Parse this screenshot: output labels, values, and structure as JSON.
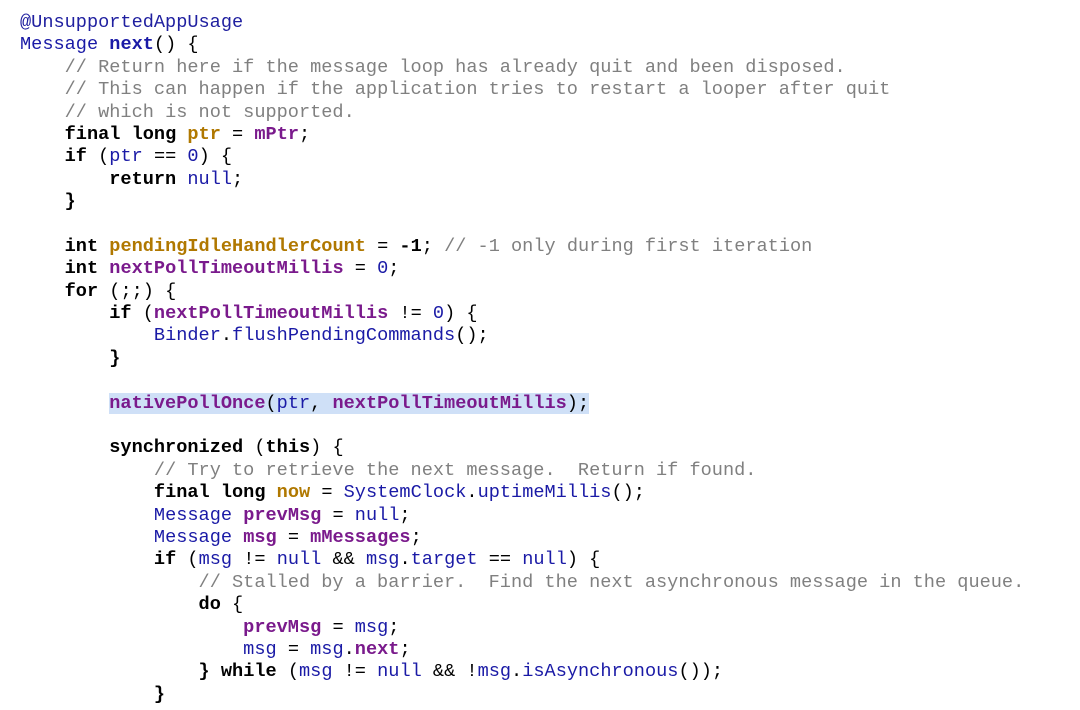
{
  "editor": {
    "lines": [
      {
        "indent": "",
        "tokens": [
          {
            "t": "@UnsupportedAppUsage",
            "c": "ann"
          }
        ]
      },
      {
        "indent": "",
        "tokens": [
          {
            "t": "Message",
            "c": "type"
          },
          {
            "t": " ",
            "c": "punc"
          },
          {
            "t": "next",
            "c": "call",
            "b": true
          },
          {
            "t": "() {",
            "c": "punc"
          }
        ]
      },
      {
        "indent": "    ",
        "tokens": [
          {
            "t": "// Return here if the message loop has already quit and been disposed.",
            "c": "com"
          }
        ]
      },
      {
        "indent": "    ",
        "tokens": [
          {
            "t": "// This can happen if the application tries to restart a looper after quit",
            "c": "com"
          }
        ]
      },
      {
        "indent": "    ",
        "tokens": [
          {
            "t": "// which is not supported.",
            "c": "com"
          }
        ]
      },
      {
        "indent": "    ",
        "tokens": [
          {
            "t": "final long",
            "c": "kw"
          },
          {
            "t": " ",
            "c": "punc"
          },
          {
            "t": "ptr",
            "c": "ptr"
          },
          {
            "t": " = ",
            "c": "punc"
          },
          {
            "t": "mPtr",
            "c": "field"
          },
          {
            "t": ";",
            "c": "punc"
          }
        ]
      },
      {
        "indent": "    ",
        "tokens": [
          {
            "t": "if",
            "c": "kw"
          },
          {
            "t": " (",
            "c": "punc"
          },
          {
            "t": "ptr",
            "c": "var"
          },
          {
            "t": " == ",
            "c": "punc"
          },
          {
            "t": "0",
            "c": "num"
          },
          {
            "t": ") {",
            "c": "punc"
          }
        ]
      },
      {
        "indent": "        ",
        "tokens": [
          {
            "t": "return",
            "c": "kw"
          },
          {
            "t": " ",
            "c": "punc"
          },
          {
            "t": "null",
            "c": "lit"
          },
          {
            "t": ";",
            "c": "punc"
          }
        ]
      },
      {
        "indent": "    ",
        "tokens": [
          {
            "t": "}",
            "c": "kw"
          }
        ]
      },
      {
        "indent": "",
        "tokens": []
      },
      {
        "indent": "    ",
        "tokens": [
          {
            "t": "int",
            "c": "kw"
          },
          {
            "t": " ",
            "c": "punc"
          },
          {
            "t": "pendingIdleHandlerCount",
            "c": "ptr"
          },
          {
            "t": " = ",
            "c": "punc"
          },
          {
            "t": "-1",
            "c": "kw"
          },
          {
            "t": "; ",
            "c": "punc"
          },
          {
            "t": "// -1 only during first iteration",
            "c": "com"
          }
        ]
      },
      {
        "indent": "    ",
        "tokens": [
          {
            "t": "int",
            "c": "kw"
          },
          {
            "t": " ",
            "c": "punc"
          },
          {
            "t": "nextPollTimeoutMillis",
            "c": "local"
          },
          {
            "t": " = ",
            "c": "punc"
          },
          {
            "t": "0",
            "c": "num"
          },
          {
            "t": ";",
            "c": "punc"
          }
        ]
      },
      {
        "indent": "    ",
        "tokens": [
          {
            "t": "for",
            "c": "kw"
          },
          {
            "t": " (;;) {",
            "c": "punc"
          }
        ]
      },
      {
        "indent": "        ",
        "tokens": [
          {
            "t": "if",
            "c": "kw"
          },
          {
            "t": " (",
            "c": "punc"
          },
          {
            "t": "nextPollTimeoutMillis",
            "c": "local"
          },
          {
            "t": " != ",
            "c": "punc"
          },
          {
            "t": "0",
            "c": "num"
          },
          {
            "t": ") {",
            "c": "punc"
          }
        ]
      },
      {
        "indent": "            ",
        "tokens": [
          {
            "t": "Binder",
            "c": "type"
          },
          {
            "t": ".",
            "c": "punc"
          },
          {
            "t": "flushPendingCommands",
            "c": "call"
          },
          {
            "t": "();",
            "c": "punc"
          }
        ]
      },
      {
        "indent": "        ",
        "tokens": [
          {
            "t": "}",
            "c": "kw"
          }
        ]
      },
      {
        "indent": "",
        "tokens": []
      },
      {
        "indent": "        ",
        "highlight": true,
        "tokens": [
          {
            "t": "nativePollOnce",
            "c": "local"
          },
          {
            "t": "(",
            "c": "punc"
          },
          {
            "t": "ptr",
            "c": "var"
          },
          {
            "t": ", ",
            "c": "punc"
          },
          {
            "t": "nextPollTimeoutMillis",
            "c": "local"
          },
          {
            "t": ");",
            "c": "punc"
          }
        ]
      },
      {
        "indent": "",
        "tokens": []
      },
      {
        "indent": "        ",
        "tokens": [
          {
            "t": "synchronized",
            "c": "kw"
          },
          {
            "t": " (",
            "c": "punc"
          },
          {
            "t": "this",
            "c": "kw"
          },
          {
            "t": ") {",
            "c": "punc"
          }
        ]
      },
      {
        "indent": "            ",
        "tokens": [
          {
            "t": "// Try to retrieve the next message.  Return if found.",
            "c": "com"
          }
        ]
      },
      {
        "indent": "            ",
        "tokens": [
          {
            "t": "final long",
            "c": "kw"
          },
          {
            "t": " ",
            "c": "punc"
          },
          {
            "t": "now",
            "c": "ptr"
          },
          {
            "t": " = ",
            "c": "punc"
          },
          {
            "t": "SystemClock",
            "c": "type"
          },
          {
            "t": ".",
            "c": "punc"
          },
          {
            "t": "uptimeMillis",
            "c": "call"
          },
          {
            "t": "();",
            "c": "punc"
          }
        ]
      },
      {
        "indent": "            ",
        "tokens": [
          {
            "t": "Message",
            "c": "type"
          },
          {
            "t": " ",
            "c": "punc"
          },
          {
            "t": "prevMsg",
            "c": "local"
          },
          {
            "t": " = ",
            "c": "punc"
          },
          {
            "t": "null",
            "c": "lit"
          },
          {
            "t": ";",
            "c": "punc"
          }
        ]
      },
      {
        "indent": "            ",
        "tokens": [
          {
            "t": "Message",
            "c": "type"
          },
          {
            "t": " ",
            "c": "punc"
          },
          {
            "t": "msg",
            "c": "local"
          },
          {
            "t": " = ",
            "c": "punc"
          },
          {
            "t": "mMessages",
            "c": "field"
          },
          {
            "t": ";",
            "c": "punc"
          }
        ]
      },
      {
        "indent": "            ",
        "tokens": [
          {
            "t": "if",
            "c": "kw"
          },
          {
            "t": " (",
            "c": "punc"
          },
          {
            "t": "msg",
            "c": "var"
          },
          {
            "t": " != ",
            "c": "punc"
          },
          {
            "t": "null",
            "c": "lit"
          },
          {
            "t": " && ",
            "c": "punc"
          },
          {
            "t": "msg",
            "c": "var"
          },
          {
            "t": ".",
            "c": "punc"
          },
          {
            "t": "target",
            "c": "var"
          },
          {
            "t": " == ",
            "c": "punc"
          },
          {
            "t": "null",
            "c": "lit"
          },
          {
            "t": ") {",
            "c": "punc"
          }
        ]
      },
      {
        "indent": "                ",
        "tokens": [
          {
            "t": "// Stalled by a barrier.  Find the next asynchronous message in the queue.",
            "c": "com"
          }
        ]
      },
      {
        "indent": "                ",
        "tokens": [
          {
            "t": "do",
            "c": "kw"
          },
          {
            "t": " {",
            "c": "punc"
          }
        ]
      },
      {
        "indent": "                    ",
        "tokens": [
          {
            "t": "prevMsg",
            "c": "local"
          },
          {
            "t": " = ",
            "c": "punc"
          },
          {
            "t": "msg",
            "c": "var"
          },
          {
            "t": ";",
            "c": "punc"
          }
        ]
      },
      {
        "indent": "                    ",
        "tokens": [
          {
            "t": "msg",
            "c": "var"
          },
          {
            "t": " = ",
            "c": "punc"
          },
          {
            "t": "msg",
            "c": "var"
          },
          {
            "t": ".",
            "c": "punc"
          },
          {
            "t": "next",
            "c": "local"
          },
          {
            "t": ";",
            "c": "punc"
          }
        ]
      },
      {
        "indent": "                ",
        "tokens": [
          {
            "t": "}",
            "c": "kw"
          },
          {
            "t": " ",
            "c": "punc"
          },
          {
            "t": "while",
            "c": "kw"
          },
          {
            "t": " (",
            "c": "punc"
          },
          {
            "t": "msg",
            "c": "var"
          },
          {
            "t": " != ",
            "c": "punc"
          },
          {
            "t": "null",
            "c": "lit"
          },
          {
            "t": " && !",
            "c": "punc"
          },
          {
            "t": "msg",
            "c": "var"
          },
          {
            "t": ".",
            "c": "punc"
          },
          {
            "t": "isAsynchronous",
            "c": "call"
          },
          {
            "t": "());",
            "c": "punc"
          }
        ]
      },
      {
        "indent": "            ",
        "tokens": [
          {
            "t": "}",
            "c": "kw"
          }
        ]
      }
    ]
  }
}
